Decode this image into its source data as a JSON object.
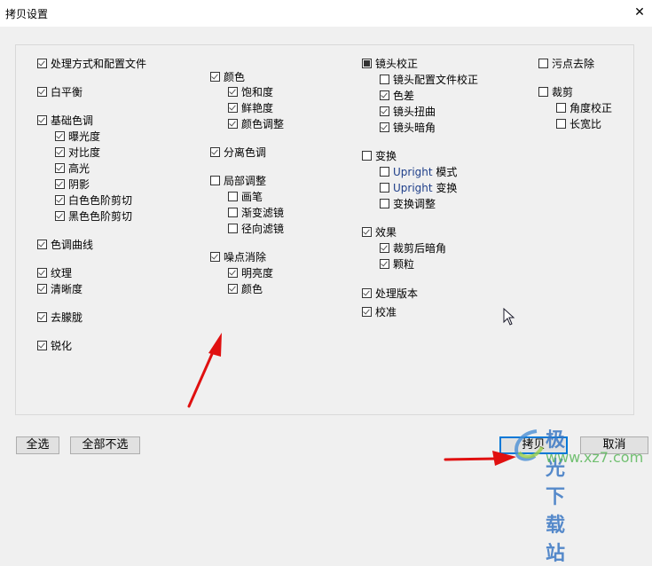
{
  "window": {
    "title": "拷贝设置",
    "close_icon": "close-icon"
  },
  "columns": [
    {
      "items": [
        {
          "label": "处理方式和配置文件",
          "state": "checked",
          "level": 0
        },
        {
          "label": "白平衡",
          "state": "checked",
          "level": 0
        },
        {
          "label": "基础色调",
          "state": "checked",
          "level": 0
        },
        {
          "label": "曝光度",
          "state": "checked",
          "level": 1
        },
        {
          "label": "对比度",
          "state": "checked",
          "level": 1
        },
        {
          "label": "高光",
          "state": "checked",
          "level": 1
        },
        {
          "label": "阴影",
          "state": "checked",
          "level": 1
        },
        {
          "label": "白色色阶剪切",
          "state": "checked",
          "level": 1
        },
        {
          "label": "黑色色阶剪切",
          "state": "checked",
          "level": 1
        },
        {
          "label": "色调曲线",
          "state": "checked",
          "level": 0
        },
        {
          "label": "纹理",
          "state": "checked",
          "level": 0
        },
        {
          "label": "清晰度",
          "state": "checked",
          "level": 0
        },
        {
          "label": "去朦胧",
          "state": "checked",
          "level": 0
        },
        {
          "label": "锐化",
          "state": "checked",
          "level": 0
        }
      ]
    },
    {
      "items": [
        {
          "label": "颜色",
          "state": "checked",
          "level": 0
        },
        {
          "label": "饱和度",
          "state": "checked",
          "level": 1
        },
        {
          "label": "鲜艳度",
          "state": "checked",
          "level": 1
        },
        {
          "label": "颜色调整",
          "state": "checked",
          "level": 1
        },
        {
          "label": "分离色调",
          "state": "checked",
          "level": 0
        },
        {
          "label": "局部调整",
          "state": "unchecked",
          "level": 0
        },
        {
          "label": "画笔",
          "state": "unchecked",
          "level": 1
        },
        {
          "label": "渐变滤镜",
          "state": "unchecked",
          "level": 1
        },
        {
          "label": "径向滤镜",
          "state": "unchecked",
          "level": 1
        },
        {
          "label": "噪点消除",
          "state": "checked",
          "level": 0
        },
        {
          "label": "明亮度",
          "state": "checked",
          "level": 1
        },
        {
          "label": "颜色",
          "state": "checked",
          "level": 1
        }
      ]
    },
    {
      "items": [
        {
          "label": "镜头校正",
          "state": "mixed",
          "level": 0
        },
        {
          "label": "镜头配置文件校正",
          "state": "unchecked",
          "level": 1
        },
        {
          "label": "色差",
          "state": "checked",
          "level": 1
        },
        {
          "label": "镜头扭曲",
          "state": "checked",
          "level": 1
        },
        {
          "label": "镜头暗角",
          "state": "checked",
          "level": 1
        },
        {
          "label": "变换",
          "state": "unchecked",
          "level": 0
        },
        {
          "label_en": "Upright",
          "label": " 模式",
          "state": "unchecked",
          "level": 1
        },
        {
          "label_en": "Upright",
          "label": " 变换",
          "state": "unchecked",
          "level": 1
        },
        {
          "label": "变换调整",
          "state": "unchecked",
          "level": 1
        },
        {
          "label": "效果",
          "state": "checked",
          "level": 0
        },
        {
          "label": "裁剪后暗角",
          "state": "checked",
          "level": 1
        },
        {
          "label": "颗粒",
          "state": "checked",
          "level": 1
        },
        {
          "label": "处理版本",
          "state": "checked",
          "level": 0
        },
        {
          "label": "校准",
          "state": "checked",
          "level": 0
        }
      ]
    },
    {
      "items": [
        {
          "label": "污点去除",
          "state": "unchecked",
          "level": 0
        },
        {
          "label": "裁剪",
          "state": "unchecked",
          "level": 0
        },
        {
          "label": "角度校正",
          "state": "unchecked",
          "level": 1
        },
        {
          "label": "长宽比",
          "state": "unchecked",
          "level": 1
        }
      ]
    }
  ],
  "buttons": {
    "select_all": "全选",
    "select_none": "全部不选",
    "copy": "拷贝",
    "cancel": "取消"
  },
  "watermark": {
    "name": "极光下载站",
    "url": "www.xz7.com"
  },
  "colors": {
    "accent": "#0078d7",
    "annotation_arrow": "#e01010"
  }
}
